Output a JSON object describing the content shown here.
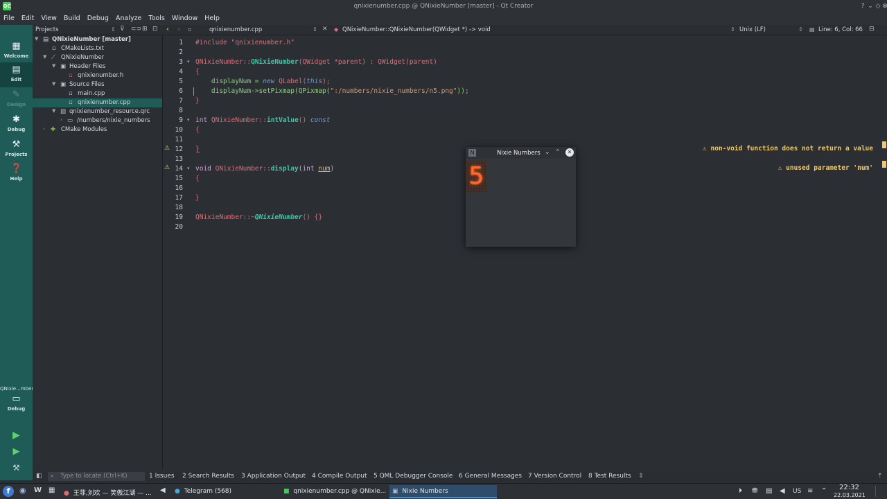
{
  "window": {
    "title": "qnixienumber.cpp @ QNixieNumber [master] - Qt Creator",
    "app_icon": "QC"
  },
  "menu": [
    "File",
    "Edit",
    "View",
    "Build",
    "Debug",
    "Analyze",
    "Tools",
    "Window",
    "Help"
  ],
  "modes": [
    {
      "label": "Welcome",
      "icon": "grid-icon"
    },
    {
      "label": "Edit",
      "icon": "edit-icon"
    },
    {
      "label": "Design",
      "icon": "pencil-icon"
    },
    {
      "label": "Debug",
      "icon": "bug-icon"
    },
    {
      "label": "Projects",
      "icon": "wrench-icon"
    },
    {
      "label": "Help",
      "icon": "help-icon"
    }
  ],
  "kit": {
    "name": "QNixie...mber",
    "config": "Debug"
  },
  "projects": {
    "header": "Projects",
    "tree": [
      {
        "label": "QNixieNumber [master]",
        "bold": true
      },
      {
        "label": "CMakeLists.txt"
      },
      {
        "label": "QNixieNumber"
      },
      {
        "label": "Header Files"
      },
      {
        "label": "qnixienumber.h"
      },
      {
        "label": "Source Files"
      },
      {
        "label": "main.cpp"
      },
      {
        "label": "qnixienumber.cpp",
        "selected": true
      },
      {
        "label": "qnixienumber_resource.qrc"
      },
      {
        "label": "/numbers/nixie_numbers"
      },
      {
        "label": "CMake Modules"
      }
    ]
  },
  "editor_toolbar": {
    "file": "qnixienumber.cpp",
    "symbol": "QNixieNumber::QNixieNumber(QWidget *) -> void",
    "line_ending": "Unix (LF)",
    "position": "Line: 6, Col: 66"
  },
  "line_numbers": [
    "1",
    "2",
    "3",
    "4",
    "5",
    "6",
    "7",
    "8",
    "9",
    "10",
    "11",
    "12",
    "13",
    "14",
    "15",
    "16",
    "17",
    "18",
    "19",
    "20"
  ],
  "code": {
    "l1": "#include \"qnixienumber.h\"",
    "l3a": "QNixieNumber::",
    "l3b": "QNixieNumber",
    "l3c": "(QWidget *parent) : QWidget(parent)",
    "l4": "{",
    "l5a": "    displayNum = ",
    "l5b": "new",
    "l5c": " QLabel(",
    "l5d": "this",
    "l5e": ");",
    "l6a": "    displayNum->setPixmap(QPixmap(",
    "l6b": "\":/numbers/nixie_numbers/n5.png\"",
    "l6c": "));",
    "l7": "}",
    "l9a": "int ",
    "l9b": "QNixieNumber::",
    "l9c": "intValue",
    "l9d": "() ",
    "l9e": "const",
    "l10": "{",
    "l12": "}",
    "l14a": "void ",
    "l14b": "QNixieNumber::",
    "l14c": "display",
    "l14d": "(int ",
    "l14e": "num",
    "l14f": ")",
    "l15": "{",
    "l17": "}",
    "l19a": "QNixieNumber::~",
    "l19b": "QNixieNumber",
    "l19c": "() {}"
  },
  "warnings": [
    {
      "text": "⚠ non-void function does not return a value"
    },
    {
      "text": "⚠ unused parameter 'num'"
    }
  ],
  "popup": {
    "title": "Nixie Numbers",
    "digit": "5"
  },
  "output_panes": {
    "locator_placeholder": "Type to locate (Ctrl+K)",
    "tabs": [
      "1  Issues",
      "2  Search Results",
      "3  Application Output",
      "4  Compile Output",
      "5  QML Debugger Console",
      "6  General Messages",
      "7  Version Control",
      "8  Test Results"
    ]
  },
  "taskbar": {
    "tasks": [
      {
        "label": "王菲,刘欢 — 笑傲江湖 — ..."
      },
      {
        "label": "Telegram (568)"
      },
      {
        "label": "qnixienumber.cpp @ QNixie..."
      },
      {
        "label": "Nixie Numbers",
        "active": true
      }
    ],
    "keyboard": "US",
    "time": "22:32",
    "date": "22.03.2021"
  },
  "colors": {
    "accent": "#1f5c57",
    "warning": "#f0c96a",
    "nixie": "#ff6a2a"
  }
}
